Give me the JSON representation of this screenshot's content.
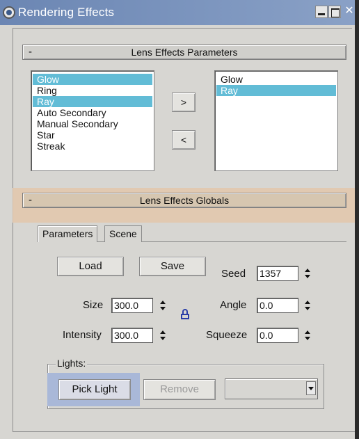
{
  "window": {
    "title": "Rendering Effects",
    "close_glyph": "✕"
  },
  "lens_params": {
    "collapse_glyph": "-",
    "title": "Lens Effects Parameters",
    "available": [
      {
        "label": "Glow",
        "selected": true
      },
      {
        "label": "Ring",
        "selected": false
      },
      {
        "label": "Ray",
        "selected": true
      },
      {
        "label": "Auto Secondary",
        "selected": false
      },
      {
        "label": "Manual Secondary",
        "selected": false
      },
      {
        "label": "Star",
        "selected": false
      },
      {
        "label": "Streak",
        "selected": false
      }
    ],
    "applied": [
      {
        "label": "Glow",
        "selected": false
      },
      {
        "label": "Ray",
        "selected": true
      }
    ],
    "add_label": ">",
    "remove_label": "<"
  },
  "lens_globals": {
    "collapse_glyph": "-",
    "title": "Lens Effects Globals",
    "tabs": [
      "Parameters",
      "Scene"
    ],
    "active_tab": "Parameters",
    "load_label": "Load",
    "save_label": "Save",
    "seed_label": "Seed",
    "seed_value": "1357",
    "size_label": "Size",
    "size_value": "300.0",
    "angle_label": "Angle",
    "angle_value": "0.0",
    "intensity_label": "Intensity",
    "intensity_value": "300.0",
    "squeeze_label": "Squeeze",
    "squeeze_value": "0.0",
    "lock_icon": "lock-icon"
  },
  "lights": {
    "group_label": "Lights:",
    "pick_label": "Pick Light",
    "remove_label": "Remove",
    "dropdown_value": ""
  },
  "colors": {
    "titlebar": "#7d96bf",
    "selection": "#62bcd6",
    "globals_highlight": "#e3c7ac",
    "pick_highlight": "#a9b8d8"
  }
}
